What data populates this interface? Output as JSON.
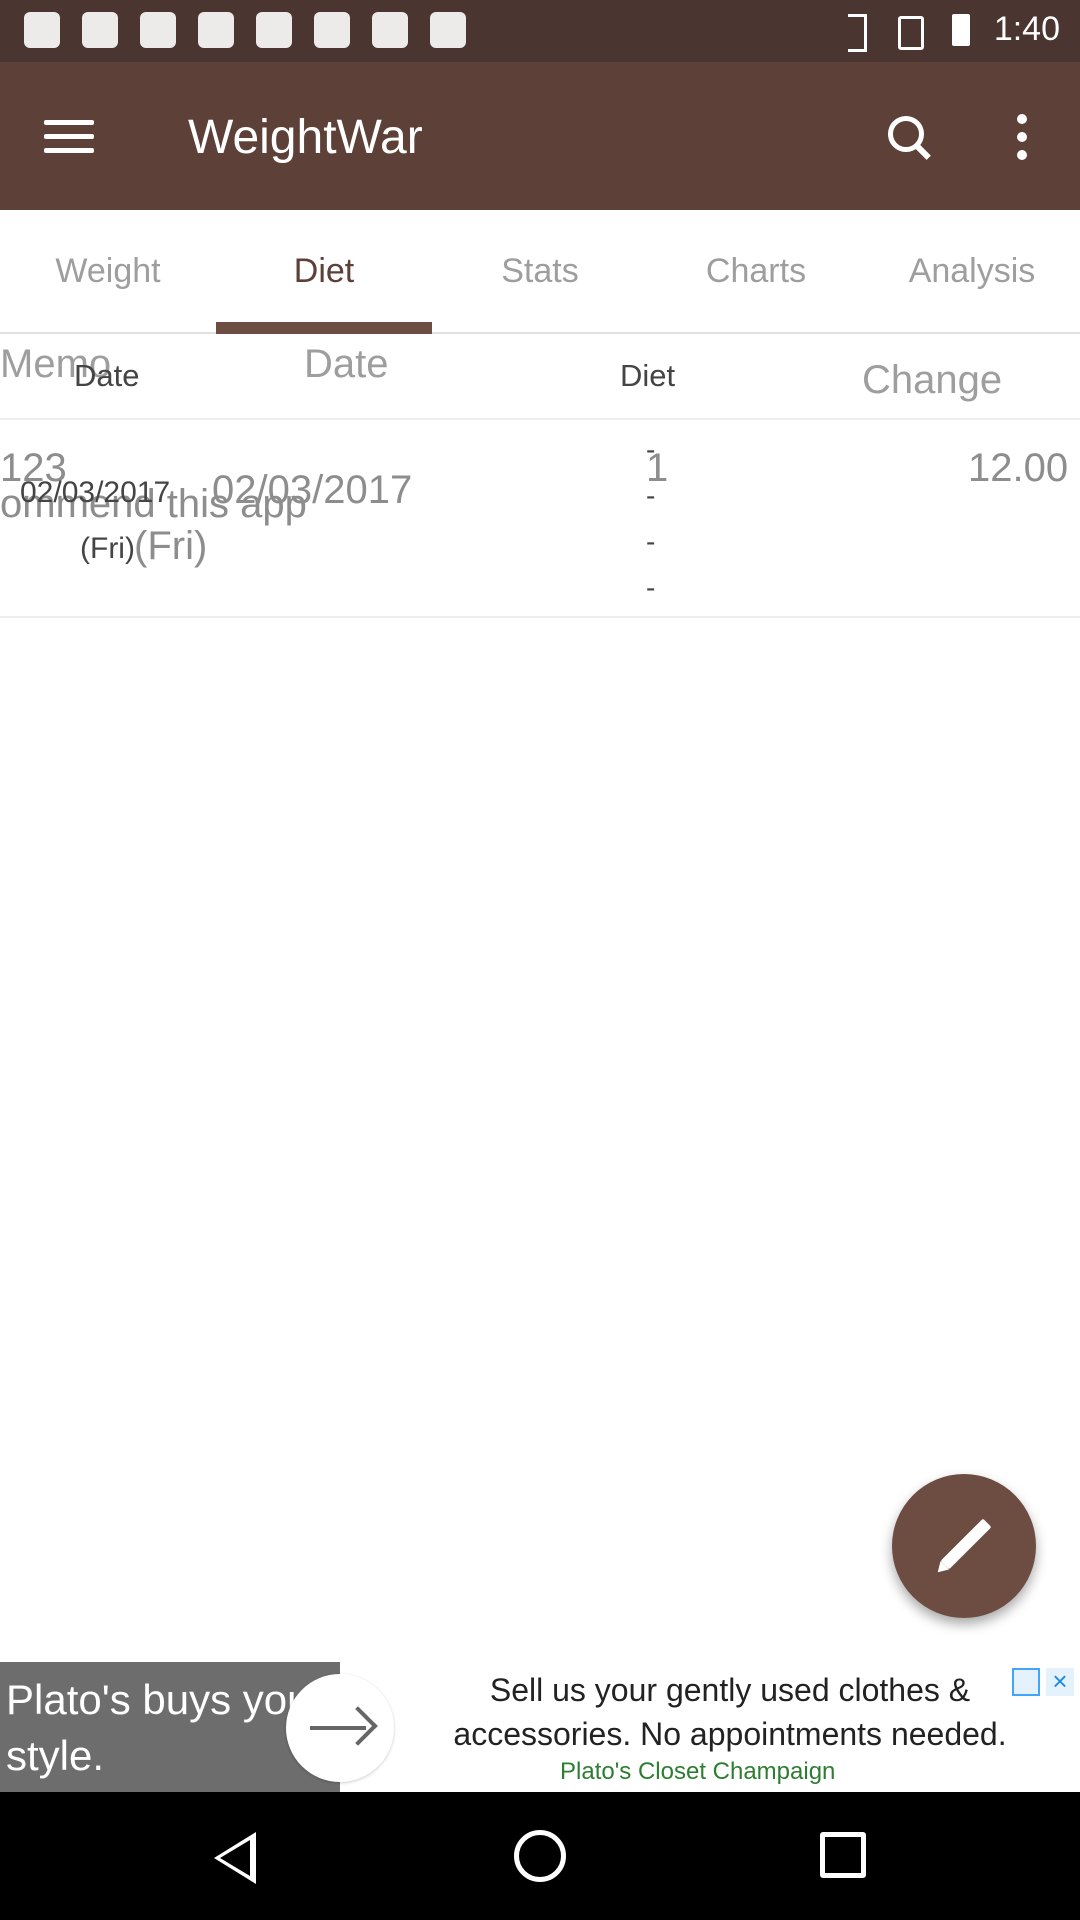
{
  "status_bar": {
    "time": "1:40"
  },
  "app_bar": {
    "title": "WeightWar"
  },
  "tabs": [
    {
      "label": "Weight"
    },
    {
      "label": "Diet"
    },
    {
      "label": "Stats"
    },
    {
      "label": "Charts"
    },
    {
      "label": "Analysis"
    }
  ],
  "active_tab": "Diet",
  "table": {
    "headers": {
      "date": "Date",
      "diet": "Diet",
      "ghost_memo": "Memo",
      "ghost_date": "Date",
      "ghost_change": "Change"
    },
    "row": {
      "date": "02/03/2017",
      "day": "(Fri)",
      "diet_lines": [
        "-",
        "-",
        "-",
        "-"
      ],
      "ghost_memo_1": "123",
      "ghost_memo_2": "ommend this app",
      "ghost_date": "02/03/2017",
      "ghost_day": "(Fri)",
      "ghost_diet": "1",
      "ghost_change": "12.00"
    }
  },
  "ad": {
    "headline": "Plato's buys your style.",
    "body": "Sell us your gently used clothes & accessories. No appointments needed.",
    "source": "Plato's Closet Champaign",
    "close": "×"
  },
  "colors": {
    "status_bar": "#4a3530",
    "app_bar": "#5d4037",
    "accent": "#6d4c41"
  }
}
